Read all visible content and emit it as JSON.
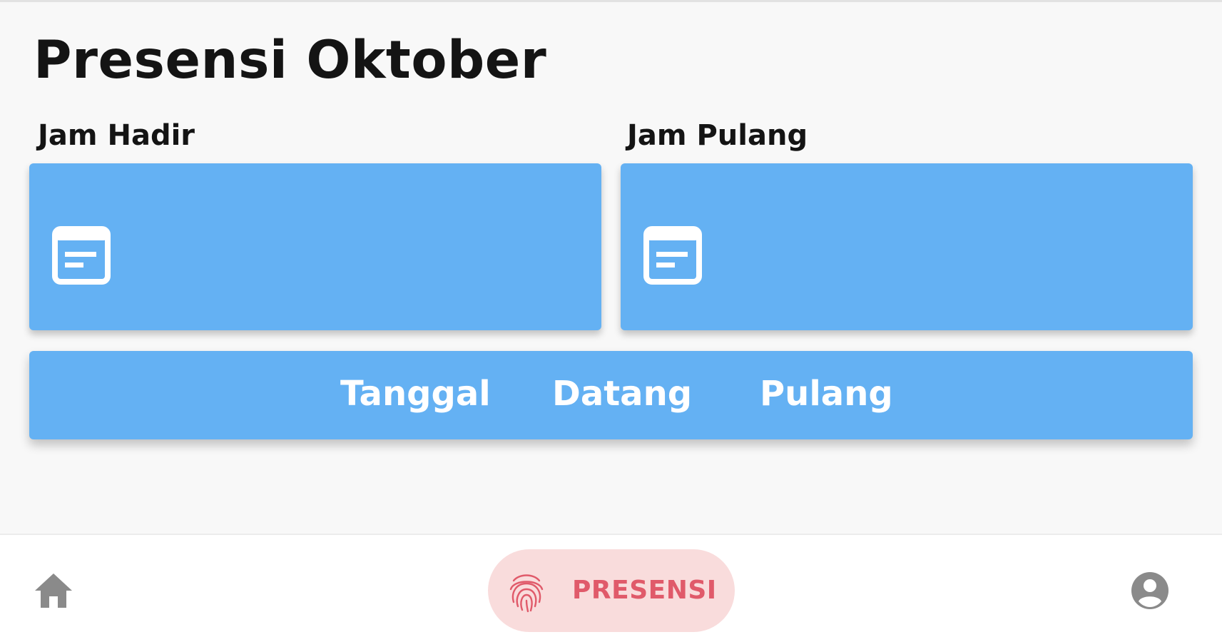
{
  "page": {
    "title": "Presensi Oktober"
  },
  "cards": {
    "hadir": {
      "label": "Jam Hadir",
      "value": "",
      "icon": "note-icon"
    },
    "pulang": {
      "label": "Jam Pulang",
      "value": "",
      "icon": "note-icon"
    }
  },
  "table": {
    "columns": [
      "Tanggal",
      "Datang",
      "Pulang"
    ]
  },
  "bottom_nav": {
    "home_icon": "home-icon",
    "presensi_label": "PRESENSI",
    "presensi_icon": "fingerprint-icon",
    "profile_icon": "account-circle-icon"
  },
  "colors": {
    "card_blue": "#64b1f3",
    "presensi_pill_bg": "#f9dcdc",
    "presensi_accent": "#e05a6a",
    "nav_icon_gray": "#8a8a8a"
  }
}
